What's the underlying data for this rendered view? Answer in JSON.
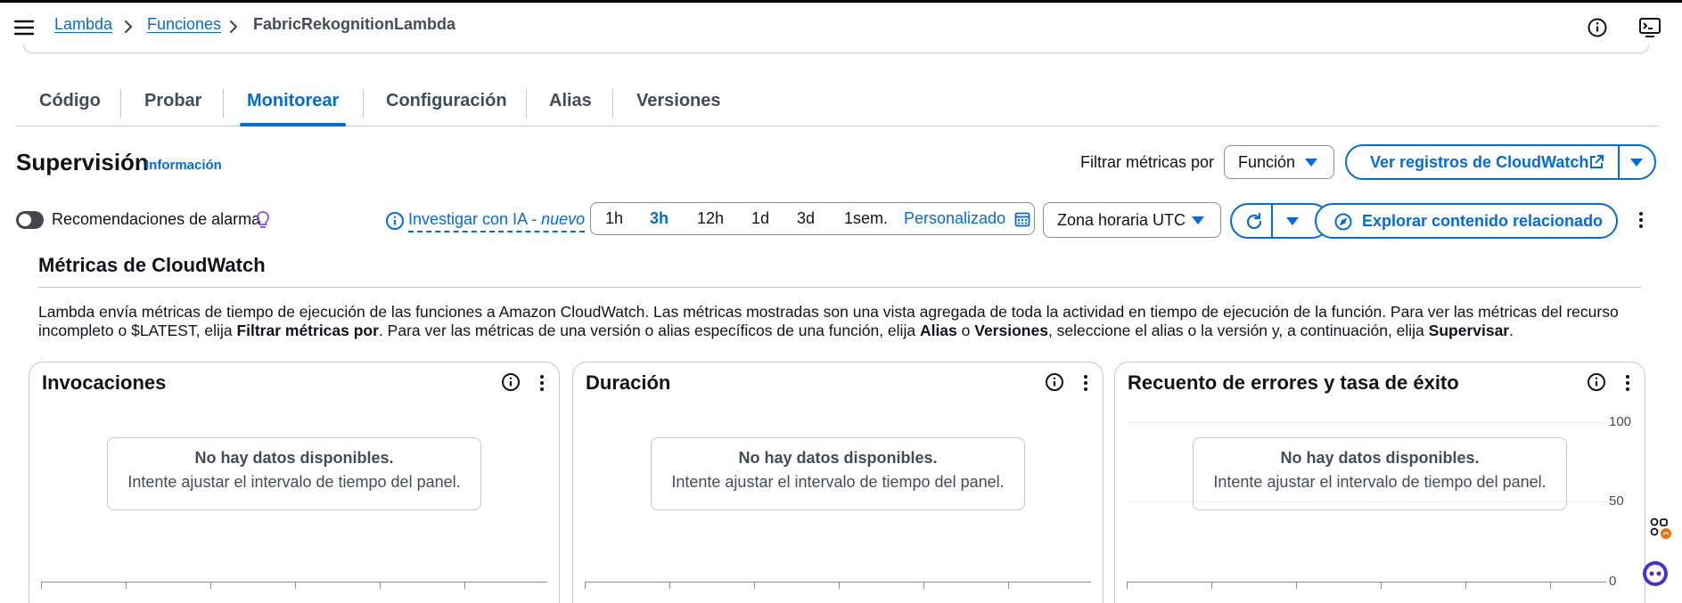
{
  "breadcrumb": {
    "items": [
      "Lambda",
      "Funciones"
    ],
    "current": "FabricRekognitionLambda"
  },
  "icons": {
    "menu": "hamburger-icon",
    "info": "info-icon",
    "console": "cloudshell-icon",
    "external": "external-link-icon",
    "refresh": "refresh-icon",
    "compass": "compass-icon",
    "calendar": "calendar-icon",
    "lightbulb": "lightbulb-icon",
    "kebab": "kebab-icon"
  },
  "tabs": [
    {
      "label": "Código",
      "active": false
    },
    {
      "label": "Probar",
      "active": false
    },
    {
      "label": "Monitorear",
      "active": true
    },
    {
      "label": "Configuración",
      "active": false
    },
    {
      "label": "Alias",
      "active": false
    },
    {
      "label": "Versiones",
      "active": false
    }
  ],
  "header": {
    "title": "Supervisión",
    "info_link": "Información",
    "filter_label": "Filtrar métricas por",
    "filter_value": "Función",
    "logs_button": "Ver registros de CloudWatch"
  },
  "controls": {
    "alarm_toggle_label": "Recomendaciones de alarma",
    "alarm_toggle_on": false,
    "ia_link": "Investigar con IA - ",
    "ia_badge": "nuevo",
    "time_ranges": [
      "1h",
      "3h",
      "12h",
      "1d",
      "3d",
      "1sem."
    ],
    "selected_range": "3h",
    "custom_range": "Personalizado",
    "timezone": "Zona horaria UTC",
    "explore_button": "Explorar contenido relacionado"
  },
  "metrics": {
    "title": "Métricas de CloudWatch",
    "desc_1": "Lambda envía métricas de tiempo de ejecución de las funciones a Amazon CloudWatch. Las métricas mostradas son una vista agregada de toda la actividad en tiempo de ejecución de la función. Para ver las métricas del recurso incompleto o $LATEST, elija ",
    "desc_b1": "Filtrar métricas por",
    "desc_2": ". Para ver las métricas de una versión o alias específicos de una función, elija ",
    "desc_b2": "Alias",
    "desc_3": " o ",
    "desc_b3": "Versiones",
    "desc_4": ", seleccione el alias o la versión y, a continuación, elija ",
    "desc_b4": "Supervisar",
    "desc_5": "."
  },
  "cards": [
    {
      "title": "Invocaciones",
      "nodata": "No hay datos disponibles.",
      "hint": "Intente ajustar el intervalo de tiempo del panel.",
      "y_ticks": []
    },
    {
      "title": "Duración",
      "nodata": "No hay datos disponibles.",
      "hint": "Intente ajustar el intervalo de tiempo del panel.",
      "y_ticks": []
    },
    {
      "title": "Recuento de errores y tasa de éxito",
      "nodata": "No hay datos disponibles.",
      "hint": "Intente ajustar el intervalo de tiempo del panel.",
      "y_ticks": [
        "100",
        "50",
        "0"
      ]
    }
  ],
  "colors": {
    "accent": "#006ce0",
    "text": "#0f141a",
    "muted": "#414d5c",
    "border": "#c6c6cd"
  }
}
